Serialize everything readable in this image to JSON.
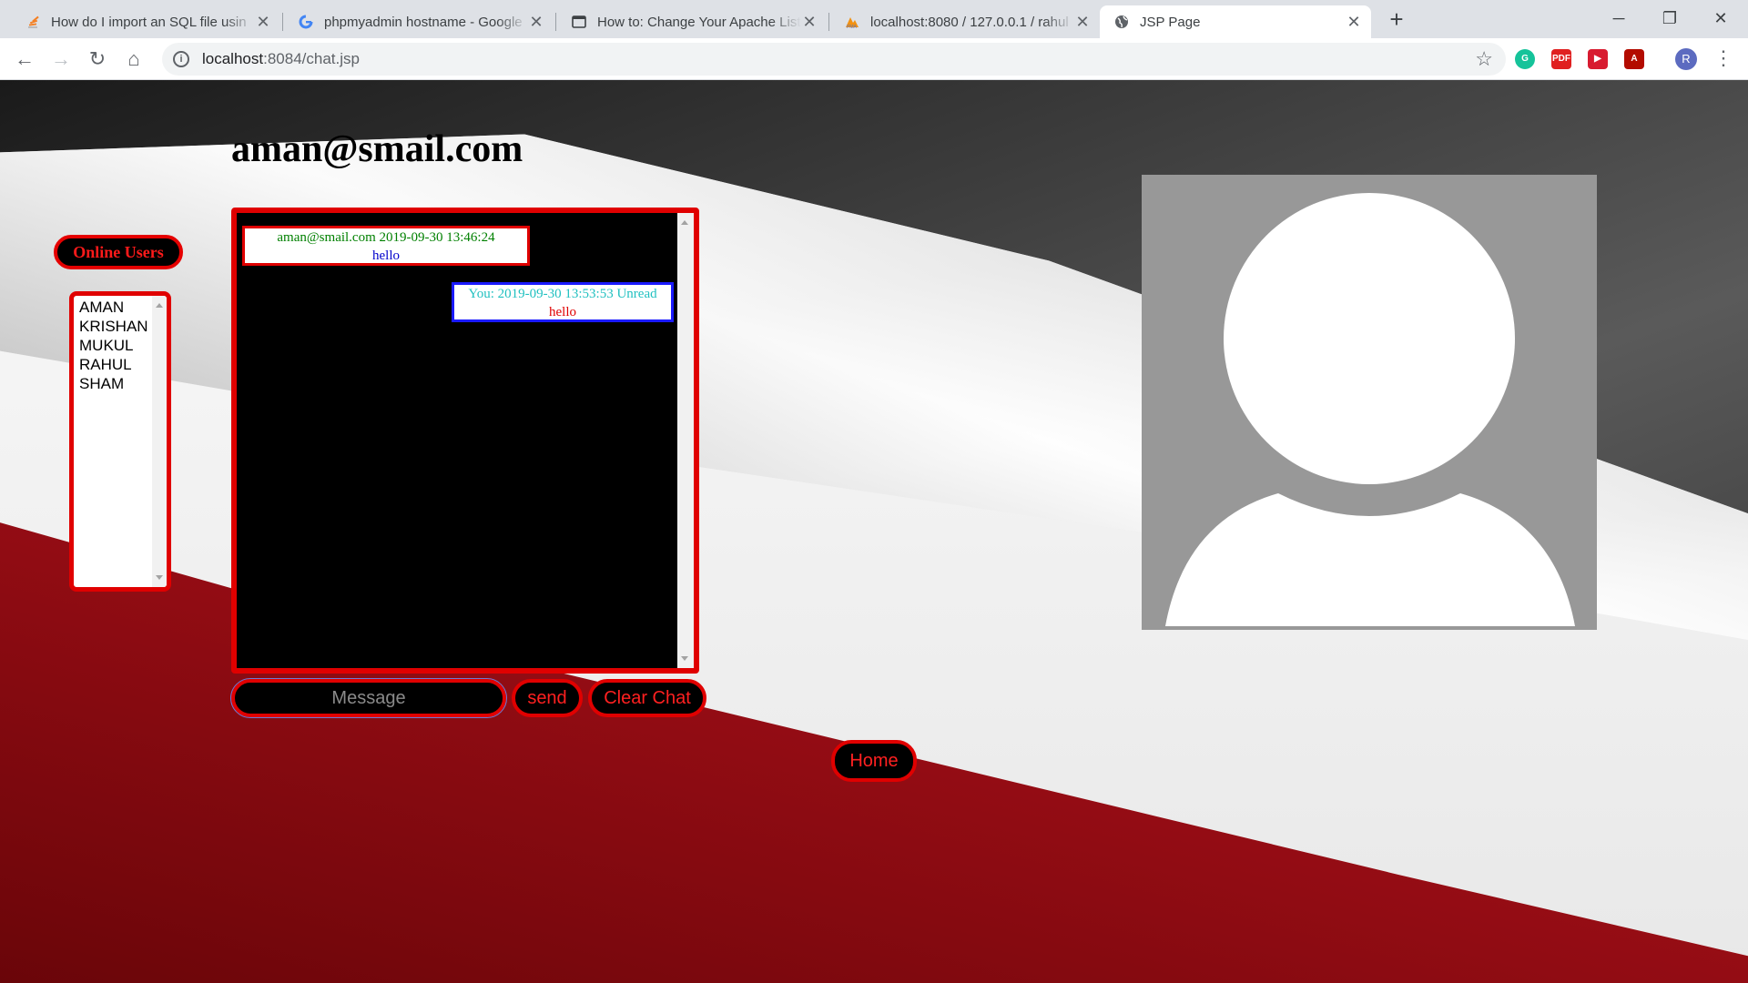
{
  "browser": {
    "tabs": [
      {
        "title": "How do I import an SQL file usin",
        "favicon": "stackoverflow-icon",
        "active": false
      },
      {
        "title": "phpmyadmin hostname - Google",
        "favicon": "google-icon",
        "active": false
      },
      {
        "title": "How to: Change Your Apache List",
        "favicon": "webpage-icon",
        "active": false
      },
      {
        "title": "localhost:8080 / 127.0.0.1 / rahul",
        "favicon": "phpmyadmin-icon",
        "active": false
      },
      {
        "title": "JSP Page",
        "favicon": "globe-icon",
        "active": true
      }
    ],
    "url_host": "localhost",
    "url_path": ":8084/chat.jsp",
    "extensions": [
      "grammarly-icon",
      "pdf-icon",
      "media-icon",
      "acrobat-icon"
    ],
    "profile_initial": "R",
    "colors": {
      "tabbar": "#dee1e6",
      "omnibox": "#f1f3f4"
    }
  },
  "page": {
    "user_email": "aman@smail.com",
    "online_users_label": "Online Users",
    "online_users": [
      "AMAN",
      "KRISHAN",
      "MUKUL",
      "RAHUL",
      "SHAM"
    ],
    "messages": [
      {
        "direction": "incoming",
        "meta": "aman@smail.com 2019-09-30 13:46:24",
        "text": "hello"
      },
      {
        "direction": "outgoing",
        "meta": "You: 2019-09-30 13:53:53 Unread",
        "text": "hello"
      }
    ],
    "message_placeholder": "Message",
    "send_label": "send",
    "clear_label": "Clear Chat",
    "home_label": "Home",
    "colors": {
      "accent": "#e00000",
      "button_bg": "#000000",
      "avatar_bg": "#989898"
    }
  }
}
